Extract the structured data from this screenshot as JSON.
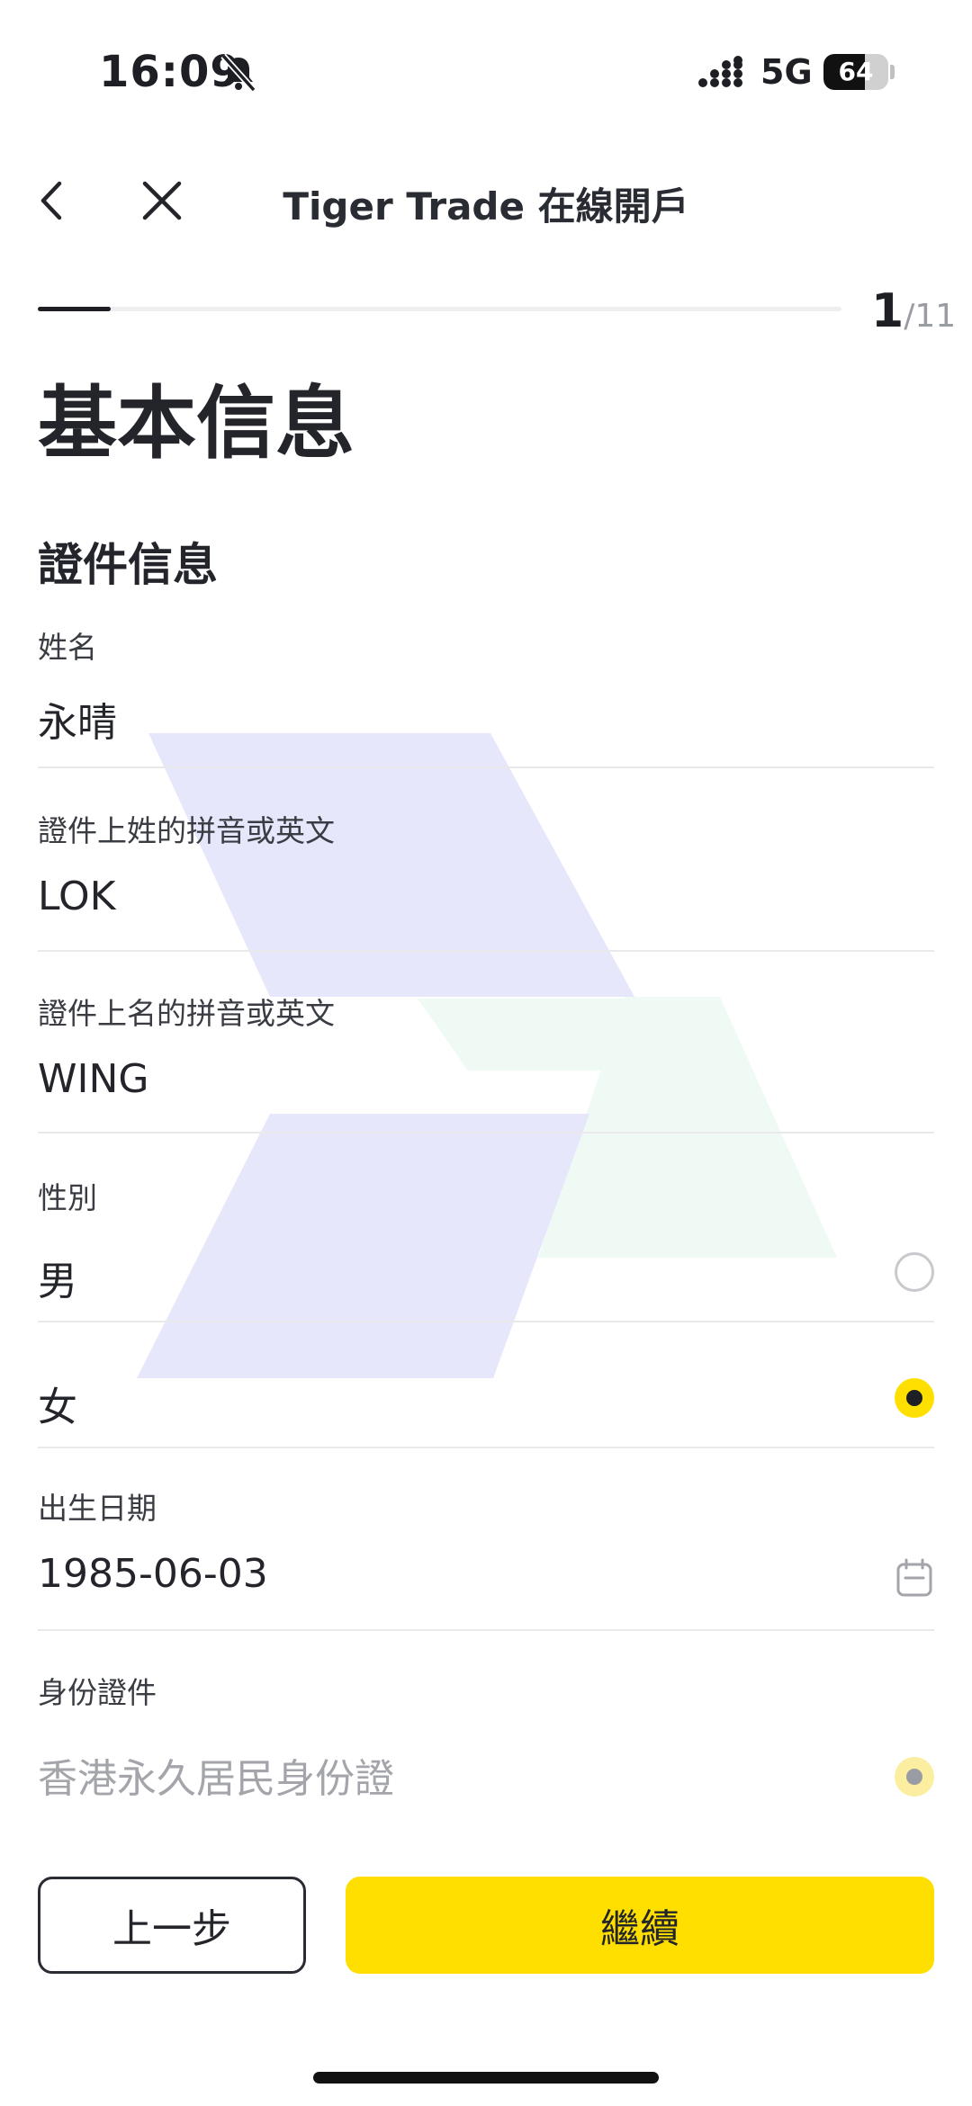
{
  "status_bar": {
    "time": "16:09",
    "network": "5G",
    "battery": "64",
    "battery_level": 0.64
  },
  "nav": {
    "title": "Tiger Trade 在線開戶"
  },
  "progress": {
    "current": "1",
    "total": "/11",
    "fraction": 0.0909
  },
  "page_title": "基本信息",
  "section_title": "證件信息",
  "form": {
    "name": {
      "label": "姓名",
      "value": "永晴"
    },
    "surname_en": {
      "label": "證件上姓的拼音或英文",
      "value": "LOK"
    },
    "given_name_en": {
      "label": "證件上名的拼音或英文",
      "value": "WING"
    },
    "gender": {
      "label": "性別",
      "options": [
        {
          "label": "男",
          "selected": false
        },
        {
          "label": "女",
          "selected": true
        }
      ]
    },
    "birth_date": {
      "label": "出生日期",
      "value": "1985-06-03"
    },
    "id_type": {
      "label": "身份證件",
      "value": "香港永久居民身份證"
    }
  },
  "buttons": {
    "prev": "上一步",
    "next": "繼續"
  },
  "colors": {
    "accent": "#ffdf00",
    "text": "#23252b",
    "watermark_blue": "#e6e7fb",
    "watermark_green": "#eefaf3"
  },
  "icons": [
    "bell-slash-icon",
    "signal-icon",
    "battery-icon",
    "back-arrow-icon",
    "close-icon",
    "calendar-icon"
  ]
}
